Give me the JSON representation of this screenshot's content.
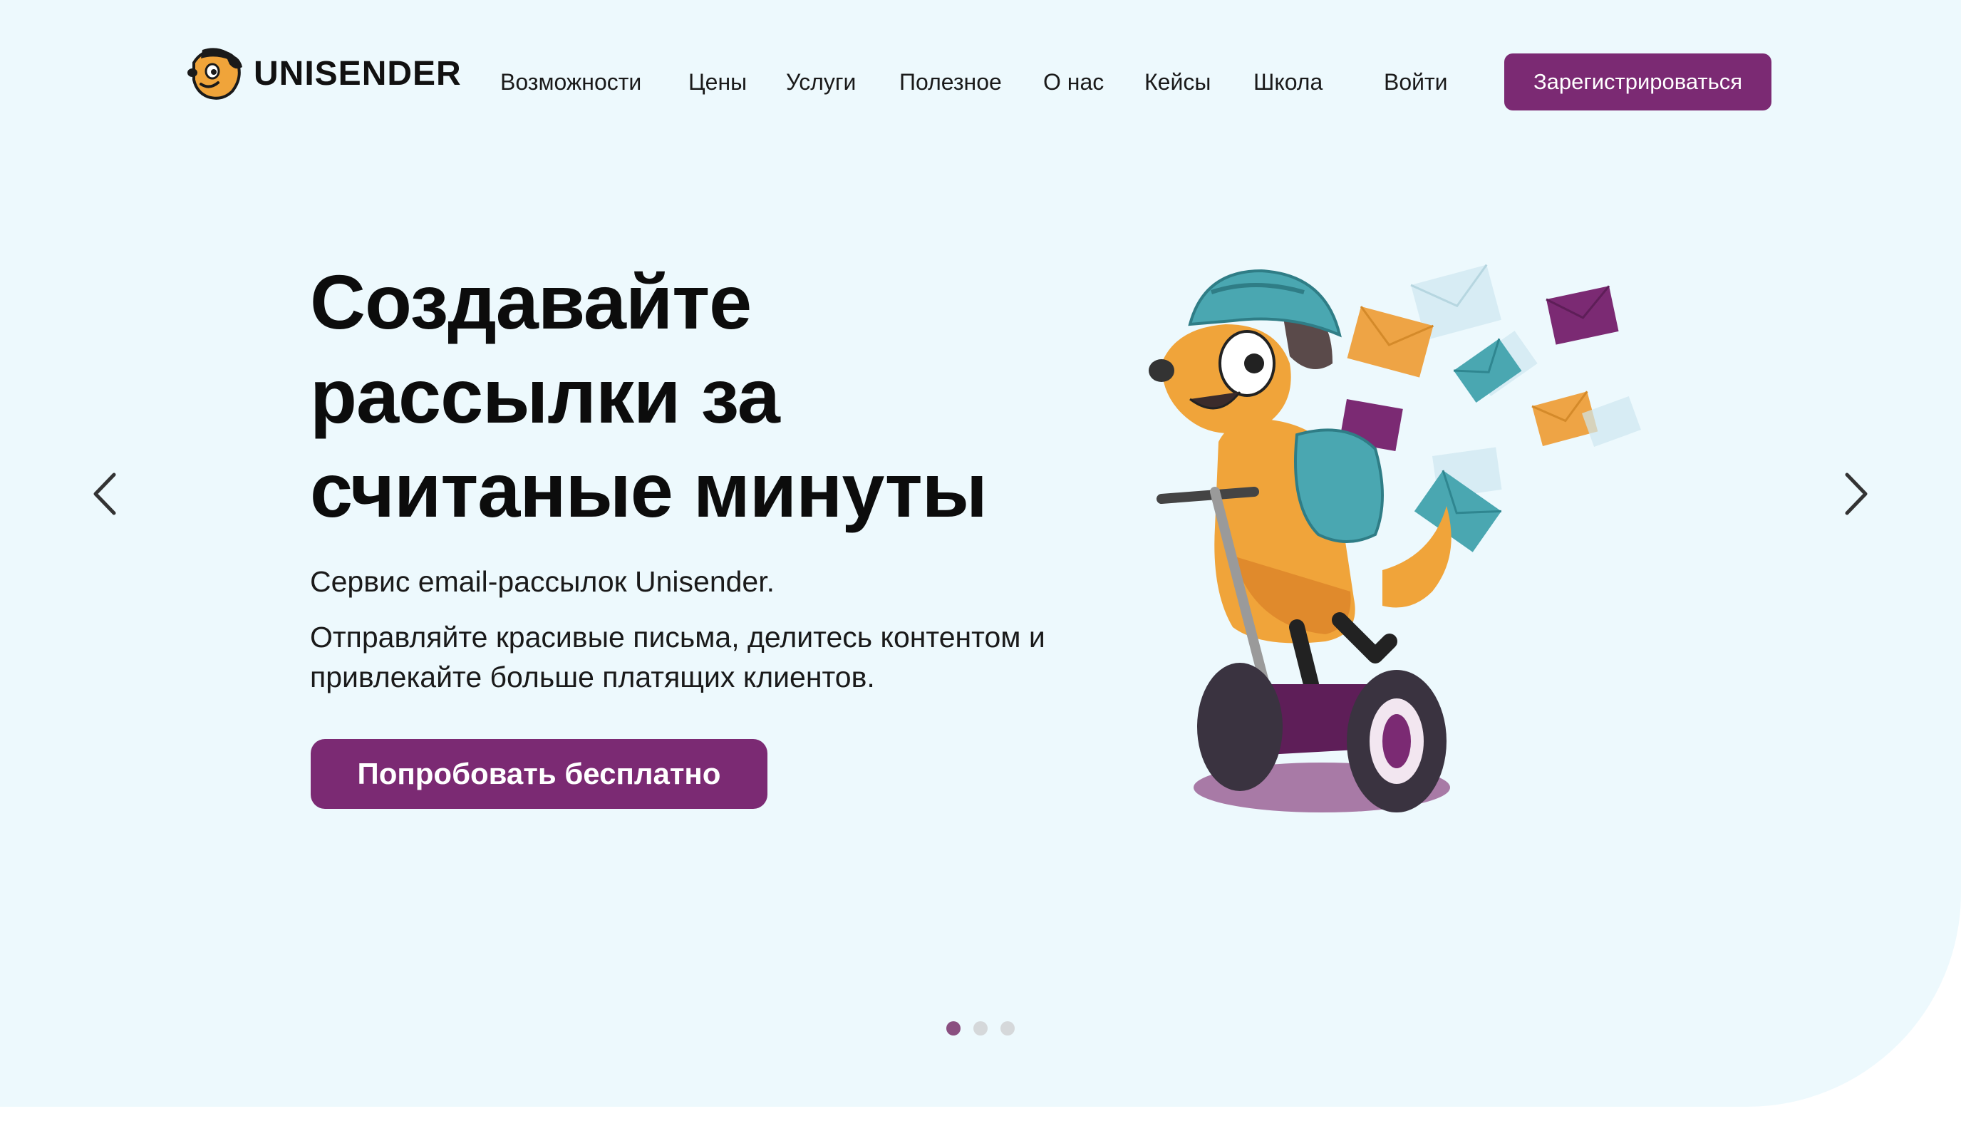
{
  "header": {
    "logo_text": "UNISENDER",
    "nav": [
      {
        "label": "Возможности"
      },
      {
        "label": "Цены"
      },
      {
        "label": "Услуги"
      },
      {
        "label": "Полезное"
      },
      {
        "label": "О нас"
      },
      {
        "label": "Кейсы"
      },
      {
        "label": "Школа"
      },
      {
        "label": "Войти"
      }
    ],
    "signup_label": "Зарегистрироваться"
  },
  "hero": {
    "headline_lines": [
      "Создавайте",
      "рассылки за",
      "считаные минуты"
    ],
    "subtitle": "Сервис email-рассылок Unisender.",
    "description_lines": [
      "Отправляйте красивые письма, делитесь контентом и",
      "привлекайте больше платящих клиентов."
    ],
    "cta_label": "Попробовать бесплатно"
  },
  "carousel": {
    "prev_icon": "chevron-left-icon",
    "next_icon": "chevron-right-icon",
    "active_slide": 1,
    "total_slides": 3
  },
  "colors": {
    "hero_background": "#edf9fd",
    "accent": "#7b2a73",
    "dot_active": "#8a4f80",
    "dot_inactive": "#d5d8da"
  }
}
